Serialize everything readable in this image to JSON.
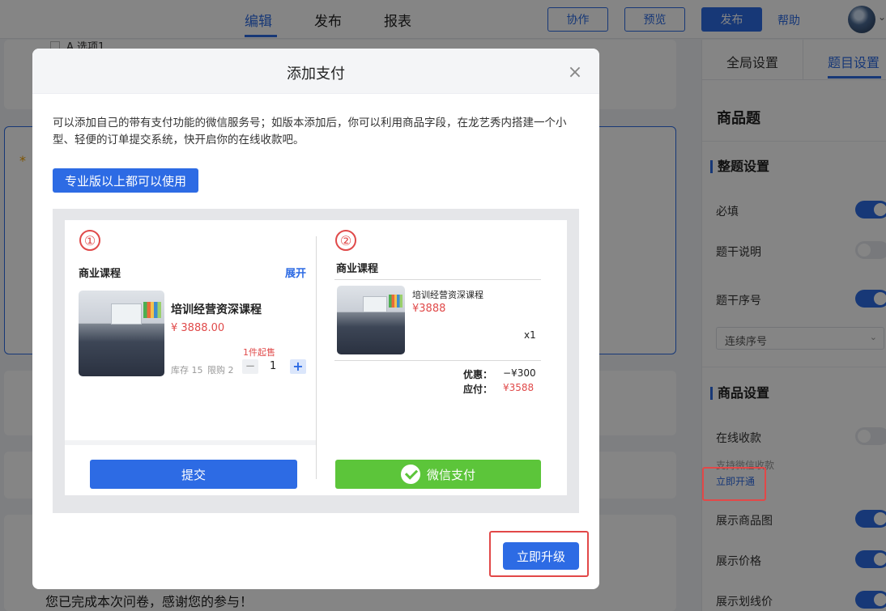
{
  "topbar": {
    "tabs": [
      {
        "label": "编辑",
        "active": true
      },
      {
        "label": "发布",
        "active": false
      },
      {
        "label": "报表",
        "active": false
      }
    ],
    "collab_label": "协作",
    "preview_label": "预览",
    "publish_label": "发布",
    "help_label": "帮助"
  },
  "editor": {
    "option_a": "A 选项1",
    "required_mark": "*",
    "finish_text": "您已完成本次问卷，感谢您的参与！"
  },
  "right_panel": {
    "tabs": [
      {
        "label": "全局设置",
        "active": false
      },
      {
        "label": "题目设置",
        "active": true
      }
    ],
    "question_type": "商品题",
    "whole_section": "整题设置",
    "required_label": "必填",
    "stem_desc_label": "题干说明",
    "stem_number_label": "题干序号",
    "number_select_value": "连续序号",
    "product_section": "商品设置",
    "online_pay_label": "在线收款",
    "wechat_note": "支持微信收款",
    "open_now_link": "立即开通",
    "show_image_label": "展示商品图",
    "show_price_label": "展示价格",
    "show_strike_label": "展示划线价",
    "toggles": {
      "required": true,
      "stem_desc": false,
      "stem_number": true,
      "online_pay": false,
      "show_image": true,
      "show_price": true,
      "show_strike": true
    }
  },
  "modal": {
    "title": "添加支付",
    "description": "可以添加自己的带有支付功能的微信服务号；如版本添加后，你可以利用商品字段，在龙艺秀内搭建一个小型、轻便的订单提交系统，快开启你的在线收款吧。",
    "pro_badge": "专业版以上都可以使用",
    "upgrade_button": "立即升级",
    "preview": {
      "step1": {
        "number": "①",
        "section": "商业课程",
        "expand": "展开",
        "product_name": "培训经营资深课程",
        "price": "¥ 3888.00",
        "min_purchase": "1件起售",
        "stock": "库存 15",
        "limit": "限购 2",
        "quantity": "1",
        "minus": "−",
        "plus": "+",
        "submit": "提交"
      },
      "step2": {
        "number": "②",
        "section": "商业课程",
        "product_name": "培训经营资深课程",
        "price": "¥3888",
        "qty": "x1",
        "discount_label": "优惠：",
        "discount_value": "−¥300",
        "payable_label": "应付：",
        "payable_value": "¥3588",
        "pay_button": "微信支付"
      }
    }
  },
  "colors": {
    "accent": "#2d6be4",
    "danger": "#e04a4a",
    "wechat": "#5cc53a",
    "warning": "#f2a100"
  }
}
